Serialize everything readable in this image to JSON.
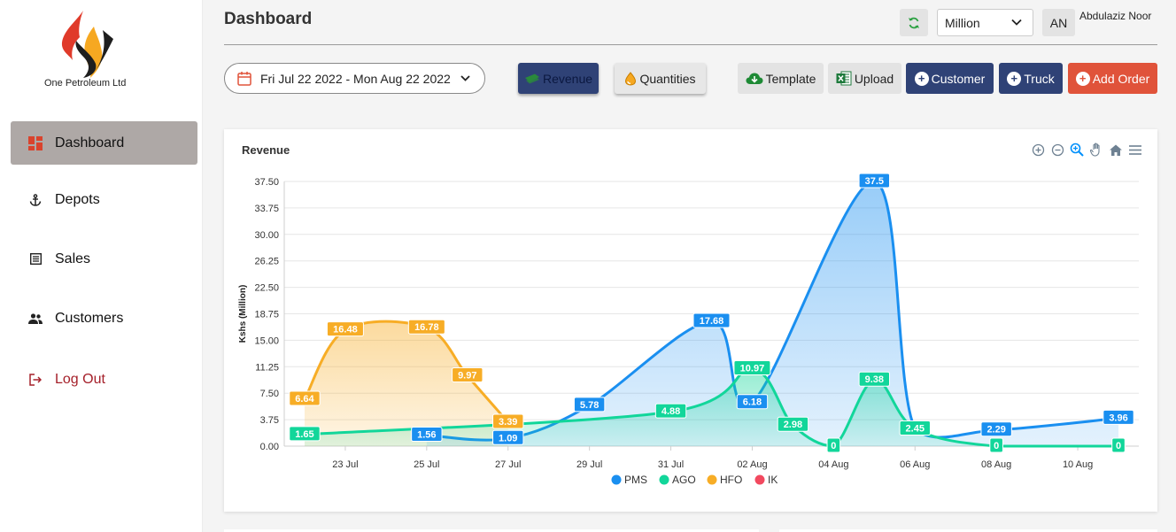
{
  "brand": {
    "name": "One Petroleum Ltd"
  },
  "sidebar": {
    "items": [
      {
        "label": "Dashboard",
        "icon": "dashboard-icon",
        "active": true
      },
      {
        "label": "Depots",
        "icon": "anchor-icon"
      },
      {
        "label": "Sales",
        "icon": "receipt-icon"
      },
      {
        "label": "Customers",
        "icon": "people-icon"
      },
      {
        "label": "Log Out",
        "icon": "logout-icon"
      }
    ]
  },
  "header": {
    "title": "Dashboard",
    "unit_select": "Million",
    "avatar_initials": "AN",
    "user_name": "Abdulaziz Noor"
  },
  "toolbar": {
    "date_range": "Fri Jul 22 2022 - Mon Aug 22 2022",
    "revenue_label": "Revenue",
    "quantities_label": "Quantities",
    "template_label": "Template",
    "upload_label": "Upload",
    "customer_label": "Customer",
    "truck_label": "Truck",
    "add_order_label": "Add Order"
  },
  "colors": {
    "primary": "#2f4276",
    "accent": "#e0533a",
    "pms": "#1a8ff0",
    "ago": "#12d69a",
    "hfo": "#f7ad26",
    "ik": "#f2495f"
  },
  "chart_data": {
    "type": "area",
    "title": "Revenue",
    "ylabel": "Kshs (Million)",
    "xlabel": "",
    "ylim": [
      0,
      37.5
    ],
    "yticks": [
      "0.00",
      "3.75",
      "7.50",
      "11.25",
      "15.00",
      "18.75",
      "22.50",
      "26.25",
      "30.00",
      "33.75",
      "37.50"
    ],
    "xlim": [
      "2022-07-22",
      "2022-08-11"
    ],
    "xticks": [
      "23 Jul",
      "25 Jul",
      "27 Jul",
      "29 Jul",
      "31 Jul",
      "02 Aug",
      "04 Aug",
      "06 Aug",
      "08 Aug",
      "10 Aug"
    ],
    "grid": true,
    "legend_position": "bottom",
    "series": [
      {
        "name": "PMS",
        "x": [
          "2022-07-25",
          "2022-07-27",
          "2022-07-29",
          "2022-08-01",
          "2022-08-02",
          "2022-08-05",
          "2022-08-06",
          "2022-08-08",
          "2022-08-11"
        ],
        "values": [
          1.56,
          1.09,
          5.78,
          17.68,
          6.18,
          37.5,
          2.45,
          2.29,
          3.96
        ]
      },
      {
        "name": "AGO",
        "x": [
          "2022-07-22",
          "2022-07-31",
          "2022-08-02",
          "2022-08-03",
          "2022-08-04",
          "2022-08-05",
          "2022-08-06",
          "2022-08-08",
          "2022-08-11"
        ],
        "values": [
          1.65,
          4.88,
          10.97,
          2.98,
          0,
          9.38,
          2.45,
          0,
          0
        ]
      },
      {
        "name": "HFO",
        "x": [
          "2022-07-22",
          "2022-07-23",
          "2022-07-25",
          "2022-07-26",
          "2022-07-27"
        ],
        "values": [
          6.64,
          16.48,
          16.78,
          9.97,
          3.39
        ]
      },
      {
        "name": "IK",
        "x": [],
        "values": []
      }
    ]
  }
}
